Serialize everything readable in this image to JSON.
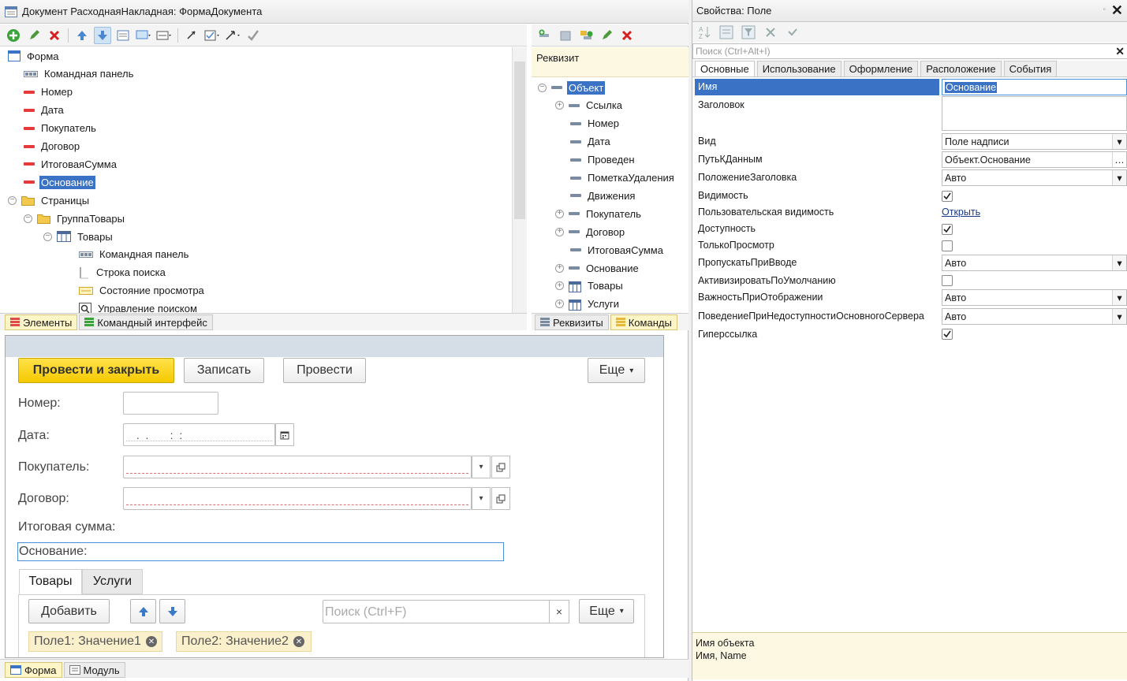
{
  "designer": {
    "title": "Документ РасходнаяНакладная: ФормаДокумента",
    "elements_tree": [
      {
        "label": "Форма",
        "icon": "form-icon"
      },
      {
        "label": "Командная панель",
        "icon": "command-panel-icon"
      },
      {
        "label": "Номер",
        "icon": "field-red-icon"
      },
      {
        "label": "Дата",
        "icon": "field-red-icon"
      },
      {
        "label": "Покупатель",
        "icon": "field-red-icon"
      },
      {
        "label": "Договор",
        "icon": "field-red-icon"
      },
      {
        "label": "ИтоговаяСумма",
        "icon": "field-red-icon"
      },
      {
        "label": "Основание",
        "icon": "field-red-icon",
        "selected": true
      },
      {
        "label": "Страницы",
        "icon": "folder-icon",
        "expander": "⊖"
      },
      {
        "label": "ГруппаТовары",
        "icon": "folder-icon",
        "expander": "⊖"
      },
      {
        "label": "Товары",
        "icon": "table-icon",
        "expander": "⊖"
      },
      {
        "label": "Командная панель",
        "icon": "command-panel-icon"
      },
      {
        "label": "Строка поиска",
        "icon": "search-string-icon"
      },
      {
        "label": "Состояние просмотра",
        "icon": "view-state-icon"
      },
      {
        "label": "Управление поиском",
        "icon": "search-control-icon"
      }
    ],
    "bottom_tabs": [
      {
        "label": "Элементы",
        "active": true
      },
      {
        "label": "Командный интерфейс",
        "active": false
      }
    ],
    "attributes": {
      "header": "Реквизит",
      "tree": [
        {
          "label": "Объект",
          "expander": "⊖",
          "selected": true
        },
        {
          "label": "Ссылка",
          "expander": "⊕"
        },
        {
          "label": "Номер",
          "expander": ""
        },
        {
          "label": "Дата",
          "expander": ""
        },
        {
          "label": "Проведен",
          "expander": ""
        },
        {
          "label": "ПометкаУдаления",
          "expander": ""
        },
        {
          "label": "Движения",
          "expander": ""
        },
        {
          "label": "Покупатель",
          "expander": "⊕"
        },
        {
          "label": "Договор",
          "expander": "⊕"
        },
        {
          "label": "ИтоговаяСумма",
          "expander": ""
        },
        {
          "label": "Основание",
          "expander": "⊕"
        },
        {
          "label": "Товары",
          "expander": "⊕",
          "table": true
        },
        {
          "label": "Услуги",
          "expander": "⊕",
          "table": true
        }
      ],
      "bottom_tabs": [
        {
          "label": "Реквизиты",
          "active": false
        },
        {
          "label": "Команды",
          "active": true
        }
      ]
    },
    "form_tabs": [
      {
        "label": "Форма",
        "active": true
      },
      {
        "label": "Модуль",
        "active": false
      }
    ]
  },
  "preview": {
    "buttons": {
      "post_close": "Провести и закрыть",
      "save": "Записать",
      "post": "Провести",
      "more": "Еще"
    },
    "fields": {
      "number_label": "Номер:",
      "date_label": "Дата:",
      "date_value": " .  .       :  :",
      "buyer_label": "Покупатель:",
      "contract_label": "Договор:",
      "total_label": "Итоговая сумма:",
      "basis_label": "Основание:"
    },
    "tabs": [
      "Товары",
      "Услуги"
    ],
    "table_toolbar": {
      "add": "Добавить",
      "search_placeholder": "Поиск (Ctrl+F)",
      "more": "Еще"
    },
    "chips": [
      "Поле1: Значение1",
      "Поле2: Значение2"
    ]
  },
  "properties": {
    "title": "Свойства: Поле",
    "search_placeholder": "Поиск (Ctrl+Alt+I)",
    "tabs": [
      "Основные",
      "Использование",
      "Оформление",
      "Расположение",
      "События"
    ],
    "rows": {
      "name_label": "Имя",
      "name_value": "Основание",
      "caption_label": "Заголовок",
      "kind_label": "Вид",
      "kind_value": "Поле надписи",
      "datapath_label": "ПутьКДанным",
      "datapath_value": "Объект.Основание",
      "titlepos_label": "ПоложениеЗаголовка",
      "titlepos_value": "Авто",
      "visible_label": "Видимость",
      "uservis_label": "Пользовательская видимость",
      "uservis_link": "Открыть",
      "enabled_label": "Доступность",
      "readonly_label": "ТолькоПросмотр",
      "skip_label": "ПропускатьПриВводе",
      "skip_value": "Авто",
      "activate_label": "АктивизироватьПоУмолчанию",
      "importance_label": "ВажностьПриОтображении",
      "importance_value": "Авто",
      "behavior_label": "ПоведениеПриНедоступностиОсновногоСервера",
      "behavior_value": "Авто",
      "hyperlink_label": "Гиперссылка"
    },
    "description": {
      "line1": "Имя объекта",
      "line2": "Имя, Name"
    }
  },
  "colors": {
    "selection": "#3a73c5",
    "primary_button": "#f5c900",
    "active_tab": "#fff6c8",
    "red_field": "#e63a3a"
  }
}
